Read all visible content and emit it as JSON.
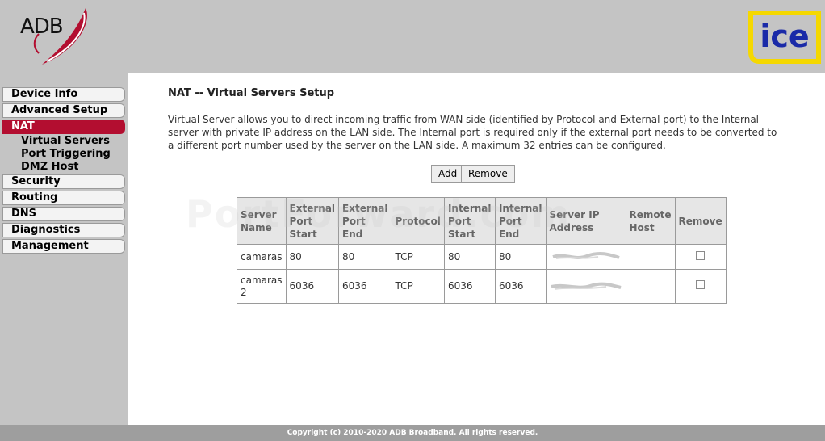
{
  "header": {
    "brand_left": "ADB",
    "brand_right": "ice"
  },
  "sidebar": {
    "items": [
      {
        "label": "Device Info"
      },
      {
        "label": "Advanced Setup"
      },
      {
        "label": "NAT"
      },
      {
        "label": "Security"
      },
      {
        "label": "Routing"
      },
      {
        "label": "DNS"
      },
      {
        "label": "Diagnostics"
      },
      {
        "label": "Management"
      }
    ],
    "nat_sub": [
      {
        "label": "Virtual Servers"
      },
      {
        "label": "Port Triggering"
      },
      {
        "label": "DMZ Host"
      }
    ]
  },
  "main": {
    "title": "NAT -- Virtual Servers Setup",
    "description": "Virtual Server allows you to direct incoming traffic from WAN side (identified by Protocol and External port) to the Internal server with private IP address on the LAN side. The Internal port is required only if the external port needs to be converted to a different port number used by the server on the LAN side. A maximum 32 entries can be configured.",
    "add_label": "Add",
    "remove_label": "Remove",
    "table": {
      "headers": [
        "Server Name",
        "External Port Start",
        "External Port End",
        "Protocol",
        "Internal Port Start",
        "Internal Port End",
        "Server IP Address",
        "Remote Host",
        "Remove"
      ],
      "rows": [
        {
          "name": "camaras",
          "ext_start": "80",
          "ext_end": "80",
          "protocol": "TCP",
          "int_start": "80",
          "int_end": "80",
          "remote_host": ""
        },
        {
          "name": "camaras 2",
          "ext_start": "6036",
          "ext_end": "6036",
          "protocol": "TCP",
          "int_start": "6036",
          "int_end": "6036",
          "remote_host": ""
        }
      ]
    }
  },
  "watermark": "PortForward.com",
  "footer": "Copyright (c) 2010-2020 ADB Broadband. All rights reserved.",
  "colors": {
    "accent": "#b30e30",
    "chrome": "#c4c4c4",
    "ice_yellow": "#f5d800",
    "ice_blue": "#1a2aa8"
  }
}
